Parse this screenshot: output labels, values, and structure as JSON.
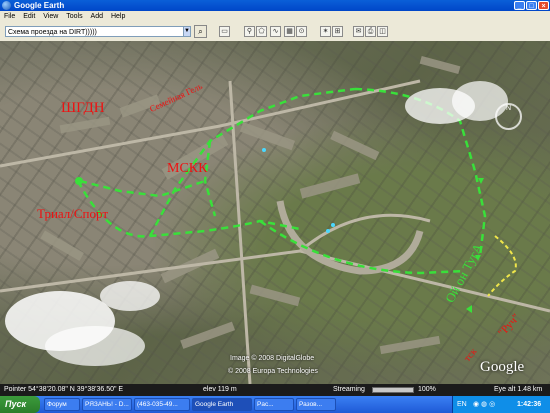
{
  "window": {
    "title": "Google Earth",
    "controls": [
      "_",
      "□",
      "×"
    ]
  },
  "menu": [
    "File",
    "Edit",
    "View",
    "Tools",
    "Add",
    "Help"
  ],
  "search": {
    "value": "Схема проезда на DIRT)))))"
  },
  "map": {
    "labels": {
      "shsh": "ШГДН",
      "zarya": "Семейная Гель",
      "mskk": "МСКК",
      "trial": "Триал/Спорт",
      "oi": "Ой он ТугА",
      "tsk": "тск",
      "ruch": "\"Руч\""
    },
    "credits": {
      "image": "Image © 2008 DigitalGlobe",
      "europa": "© 2008 Europa Technologies"
    },
    "logo": "Google",
    "compass": "N"
  },
  "status": {
    "pointer": "Pointer  54°38'20.08\" N   39°38'36.50\" E",
    "elev": "elev  119 m",
    "streaming_label": "Streaming",
    "streaming_percent": 100,
    "streaming_text": "100%",
    "eye_alt": "Eye alt  1.48 km"
  },
  "taskbar": {
    "start": "Пуск",
    "tasks": [
      "Форум",
      "РЯЗАНЬ! - D...",
      "(463-035-49...",
      "Google Earth",
      "Pac...",
      "Разов..."
    ],
    "lang": "EN",
    "clock": "1:42:36"
  }
}
